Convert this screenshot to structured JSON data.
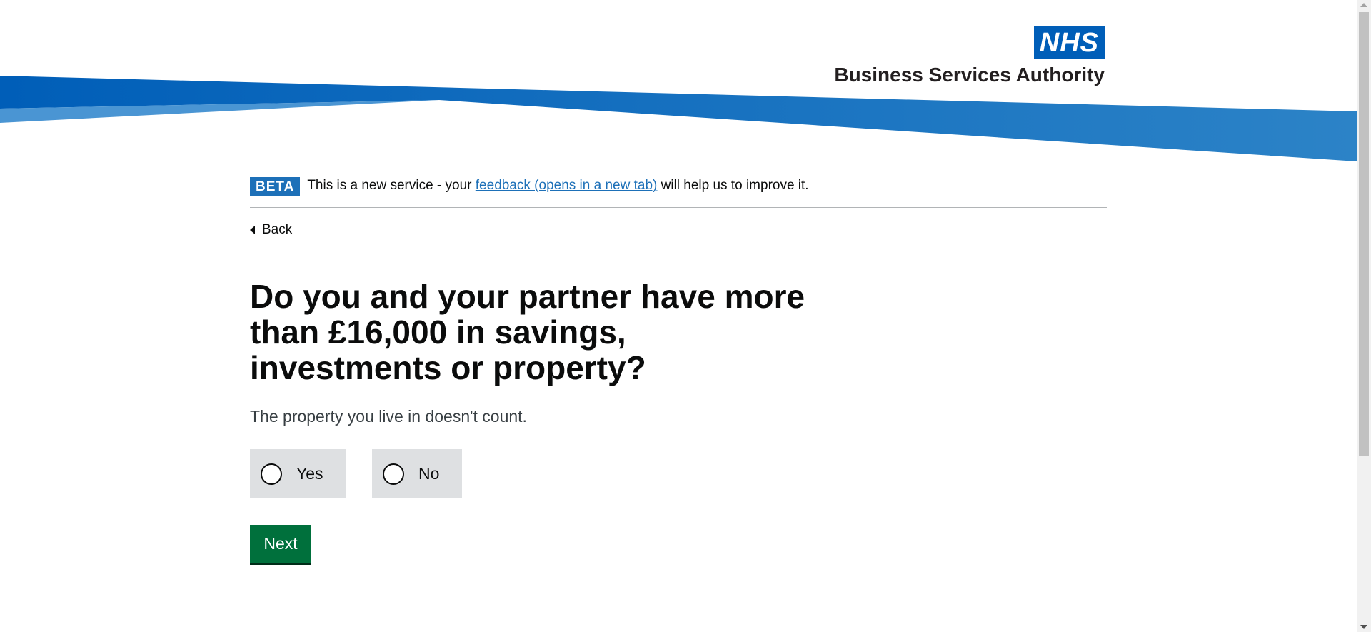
{
  "header": {
    "logo_mark": "NHS",
    "organisation": "Business Services Authority"
  },
  "phase_banner": {
    "tag": "BETA",
    "text_before": "This is a new service - your ",
    "link_text": "feedback (opens in a new tab)",
    "text_after": " will help us to improve it."
  },
  "back_link": "Back",
  "question": {
    "heading": "Do you and your partner have more than £16,000 in savings, investments or property?",
    "hint": "The property you live in doesn't count.",
    "options": [
      {
        "label": "Yes",
        "selected": false
      },
      {
        "label": "No",
        "selected": false
      }
    ]
  },
  "next_button": "Next",
  "colors": {
    "nhs_blue": "#005eb8",
    "banner_blue": "#1d70b8",
    "button_green": "#00703c",
    "radio_bg": "#dee0e2",
    "link": "#1d70b8"
  }
}
